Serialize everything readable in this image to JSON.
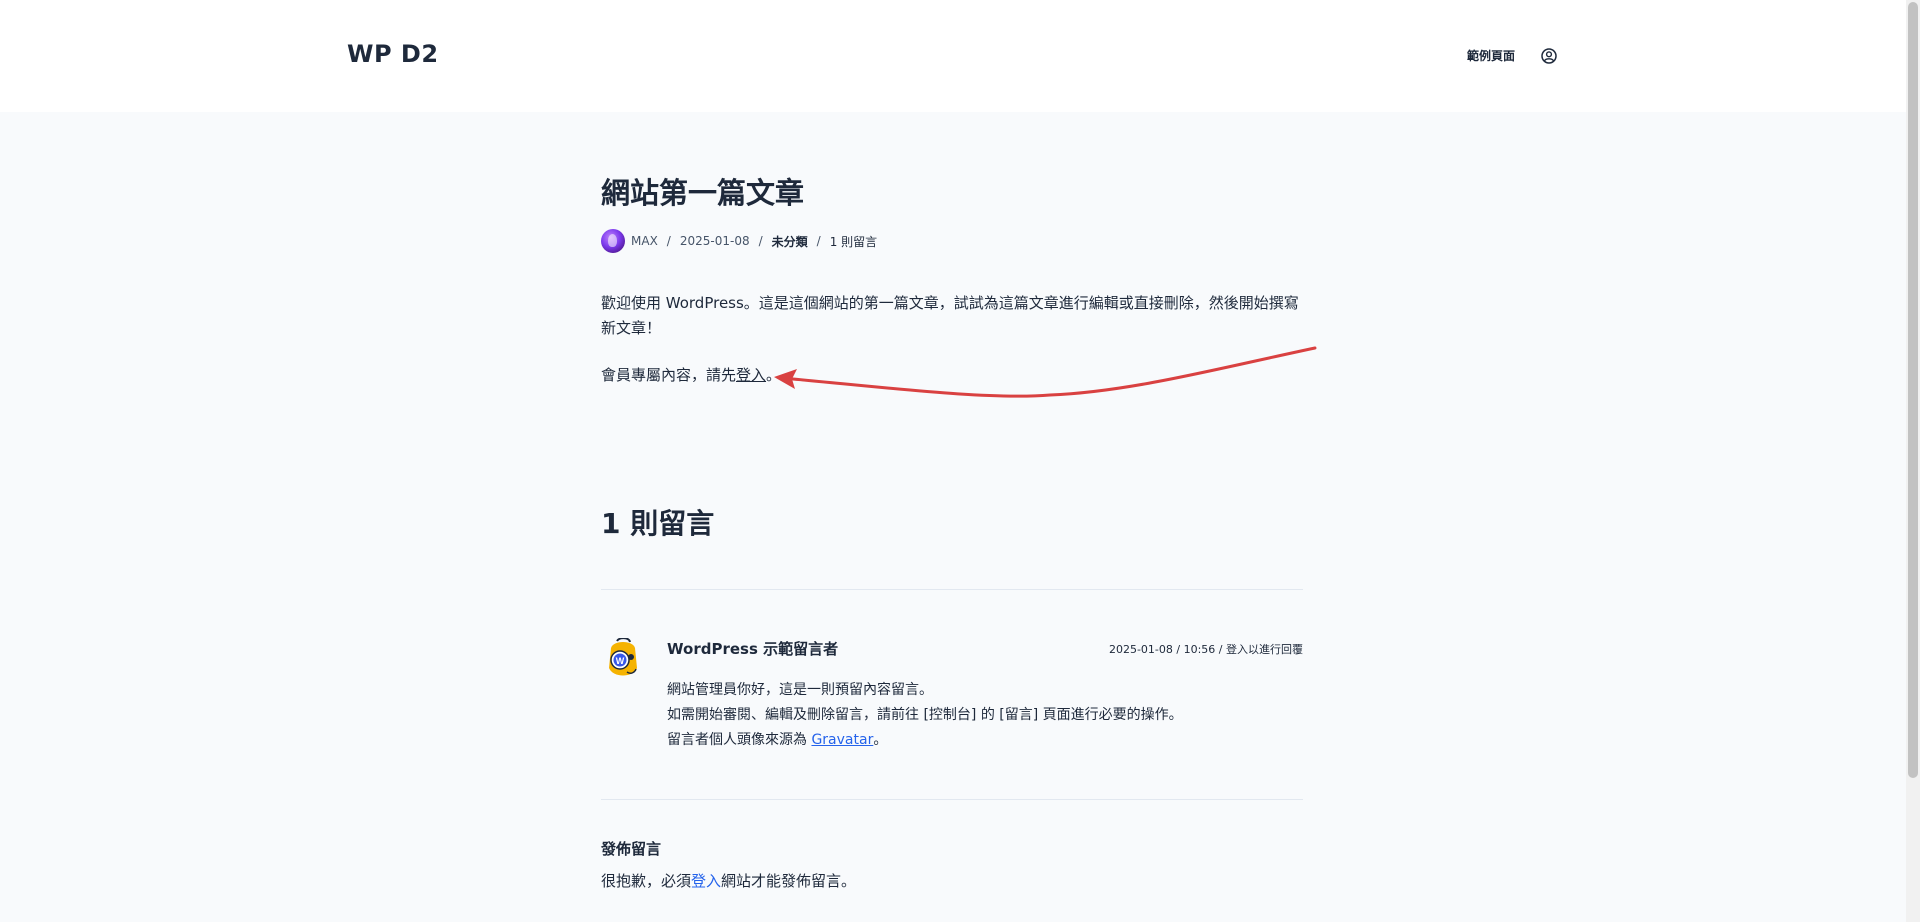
{
  "header": {
    "site_title": "WP D2",
    "nav": [
      {
        "label": "範例頁面"
      }
    ],
    "account_icon": "user-circle-icon"
  },
  "post": {
    "title": "網站第一篇文章",
    "meta": {
      "author": "MAX",
      "date": "2025-01-08",
      "category": "未分類",
      "comment_count": "1 則留言"
    },
    "paragraph1": "歡迎使用 WordPress。這是這個網站的第一篇文章，試試為這篇文章進行編輯或直接刪除，然後開始撰寫新文章！",
    "members_prefix": "會員專屬內容，請先",
    "members_link": "登入",
    "members_suffix": "。"
  },
  "annotation": {
    "color": "#d94141"
  },
  "comments": {
    "title": "1 則留言",
    "items": [
      {
        "author": "WordPress 示範留言者",
        "date": "2025-01-08 / 10:56",
        "separator": " / ",
        "reply_text": "登入以進行回覆",
        "lines": [
          "網站管理員你好，這是一則預留內容留言。",
          "如需開始審閱、編輯及刪除留言，請前往 [控制台] 的 [留言] 頁面進行必要的操作。"
        ],
        "line3_prefix": "留言者個人頭像來源為 ",
        "line3_link": "Gravatar",
        "line3_suffix": "。"
      }
    ]
  },
  "reply": {
    "title": "發佈留言",
    "note_prefix": "很抱歉，必須",
    "note_link": "登入",
    "note_suffix": "網站才能發佈留言。"
  },
  "colors": {
    "text": "#1e293b",
    "link": "#2563eb",
    "background": "#f8fafc",
    "header_background": "#ffffff"
  }
}
